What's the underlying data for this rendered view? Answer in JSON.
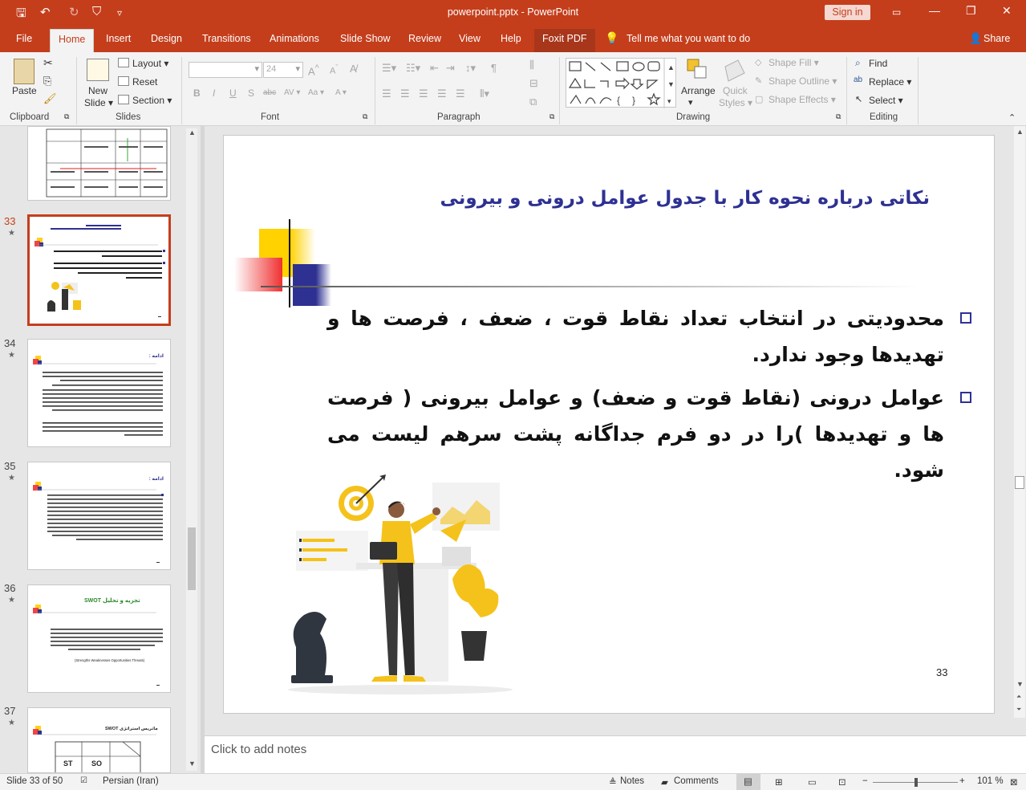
{
  "titlebar": {
    "doc_title": "powerpoint.pptx - PowerPoint",
    "signin": "Sign in",
    "min": "—",
    "restore": "❐",
    "close": "✕",
    "save": "🖫",
    "undo": "↶",
    "redo": "↻",
    "touch": "⛉",
    "customize": "▿"
  },
  "tabs": [
    "File",
    "Home",
    "Insert",
    "Design",
    "Transitions",
    "Animations",
    "Slide Show",
    "Review",
    "View",
    "Help",
    "Foxit PDF"
  ],
  "tellme": "Tell me what you want to do",
  "share": "Share",
  "groups": {
    "clipboard": "Clipboard",
    "slides": "Slides",
    "font": "Font",
    "paragraph": "Paragraph",
    "drawing": "Drawing",
    "editing": "Editing"
  },
  "buttons": {
    "paste": "Paste",
    "new_slide_1": "New",
    "new_slide_2": "Slide ▾",
    "layout": "Layout ▾",
    "reset": "Reset",
    "section": "Section ▾",
    "font_size": "24",
    "arrange": "Arrange",
    "quick_styles_1": "Quick",
    "quick_styles_2": "Styles ▾",
    "shape_fill": "Shape Fill ▾",
    "shape_outline": "Shape Outline ▾",
    "shape_effects": "Shape Effects ▾",
    "find": "Find",
    "replace": "Replace ▾",
    "select": "Select ▾",
    "font_fmt": [
      "B",
      "I",
      "U",
      "S",
      "abc",
      "AV ▾",
      "Aa ▾",
      "A ▾"
    ]
  },
  "thumbs": [
    {
      "num": "33",
      "star": "★"
    },
    {
      "num": "34",
      "star": "★",
      "title": "ادامه :"
    },
    {
      "num": "35",
      "star": "★",
      "title": "ادامه :"
    },
    {
      "num": "36",
      "star": "★",
      "title": "تجزیه و تحلیل SWOT",
      "caption": "(Strengths Weaknesses Opportunities Threats)"
    },
    {
      "num": "37",
      "star": "★",
      "title": "ماتریس استراتژی SWOT",
      "cells": [
        "ST",
        "SO"
      ]
    }
  ],
  "slide": {
    "title": "نکاتی درباره نحوه کار با جدول عوامل درونی و بیرونی",
    "bullets": [
      "محدودیتی در انتخاب تعداد نقاط قوت ، ضعف ، فرصت ها و تهدیدها وجود ندارد.",
      "عوامل درونی (نقاط قوت و ضعف) و عوامل بیرونی ( فرصت ها و تهدیدها )را در دو فرم جداگانه پشت سرهم لیست می شود."
    ],
    "number": "33"
  },
  "notes_placeholder": "Click to add notes",
  "status": {
    "slide": "Slide 33 of 50",
    "language": "Persian (Iran)",
    "notes": "Notes",
    "comments": "Comments",
    "zoom": "101 %",
    "minus": "−",
    "plus": "+"
  },
  "colors": {
    "accent": "#c43e1c",
    "title": "#2e3192"
  }
}
